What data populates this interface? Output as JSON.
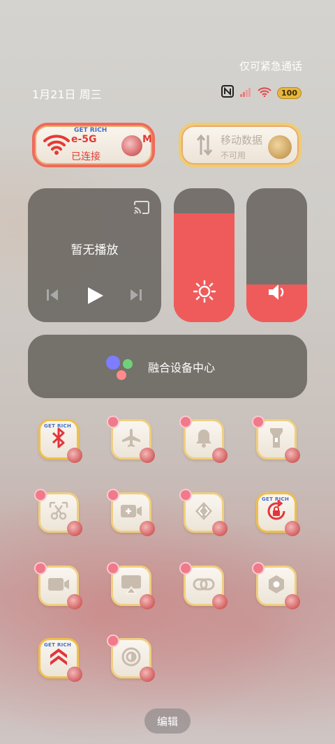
{
  "status": {
    "emergency_text": "仅可紧急通话",
    "date": "1月21日 周三",
    "battery": "100"
  },
  "wifi_tile": {
    "badge": "GET RICH",
    "ssid": "e-5G",
    "ssid_suffix": "M",
    "state": "已连接",
    "accent": "#f0433a"
  },
  "data_tile": {
    "title": "移动数据",
    "state": "不可用"
  },
  "media": {
    "title": "暂无播放"
  },
  "brightness": {
    "level": 0.81
  },
  "volume": {
    "level": 0.28
  },
  "hub": {
    "label": "融合设备中心"
  },
  "tiles": [
    {
      "name": "bluetooth",
      "badge": "GET RICH",
      "active": true
    },
    {
      "name": "airplane-mode",
      "active": false
    },
    {
      "name": "do-not-disturb",
      "active": false
    },
    {
      "name": "flashlight",
      "active": false
    },
    {
      "name": "screenshot",
      "active": false
    },
    {
      "name": "screen-record",
      "active": false
    },
    {
      "name": "screen-cast",
      "active": false
    },
    {
      "name": "rotation-lock",
      "badge": "GET RICH",
      "active": true
    },
    {
      "name": "video-call",
      "active": false
    },
    {
      "name": "screen-mirror",
      "active": false
    },
    {
      "name": "link",
      "active": false
    },
    {
      "name": "settings-hex",
      "active": false
    },
    {
      "name": "boost",
      "badge": "GET RICH",
      "active": true
    },
    {
      "name": "dark-mode",
      "active": false
    }
  ],
  "edit_label": "编辑"
}
